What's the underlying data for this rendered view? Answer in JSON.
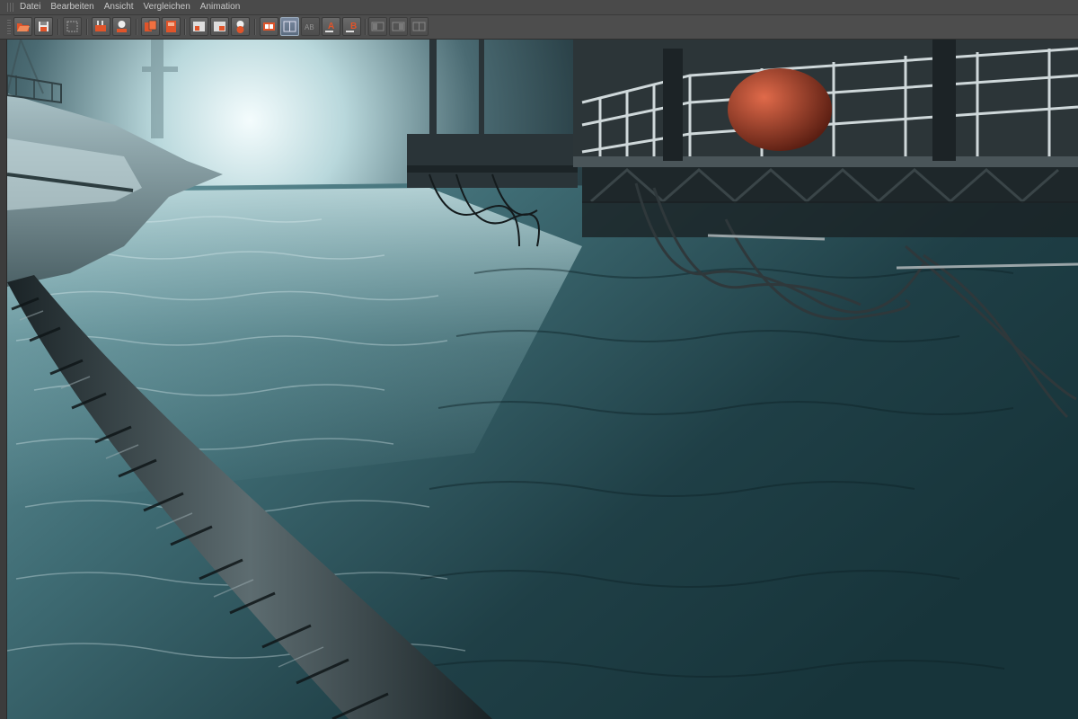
{
  "menu": {
    "items": [
      "Datei",
      "Bearbeiten",
      "Ansicht",
      "Vergleichen",
      "Animation"
    ]
  },
  "toolbar": {
    "buttons": [
      {
        "name": "open-image-icon",
        "active": false
      },
      {
        "name": "save-image-icon",
        "active": false
      },
      {
        "name": "region-render-icon",
        "active": false
      },
      {
        "name": "render-frame-icon",
        "active": false
      },
      {
        "name": "stop-render-icon",
        "active": false
      },
      {
        "name": "layer-copy-icon",
        "active": false
      },
      {
        "name": "layer-stack-icon",
        "active": false
      },
      {
        "name": "snapshot-icon",
        "active": false
      },
      {
        "name": "snapshot-view-icon",
        "active": false
      },
      {
        "name": "snapshot-person-icon",
        "active": false
      },
      {
        "name": "filmstrip-icon",
        "active": false
      },
      {
        "name": "compare-split-icon",
        "active": true
      },
      {
        "name": "compare-ab-icon",
        "active": false
      },
      {
        "name": "set-a-icon",
        "active": false
      },
      {
        "name": "set-b-icon",
        "active": false
      },
      {
        "name": "compare-left-icon",
        "active": false
      },
      {
        "name": "compare-right-icon",
        "active": false
      },
      {
        "name": "compare-swap-icon",
        "active": false
      }
    ],
    "labels": {
      "set_a": "A",
      "set_b": "B",
      "ab": "AB"
    }
  },
  "colors": {
    "accent_orange": "#e0542a",
    "water_dark": "#1d3a40",
    "fog_light": "#dff4f6"
  }
}
